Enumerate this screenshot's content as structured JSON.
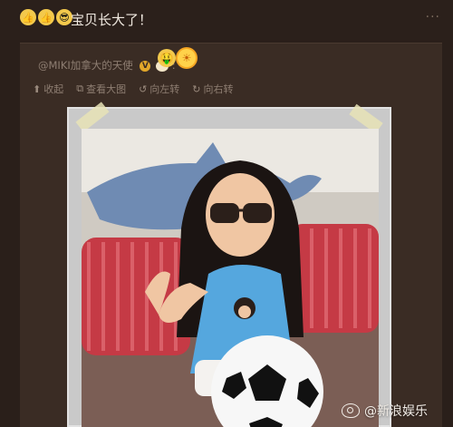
{
  "post": {
    "text": "宝贝长大了！",
    "emojis": [
      "thumbs-up-icon",
      "thumbs-up-icon",
      "cool-face-icon"
    ],
    "menu": "···"
  },
  "repost": {
    "username": "@MIKI加拿大的天使",
    "verified_badge": "V",
    "emojis": [
      "money-face-icon",
      "sun-face-icon"
    ]
  },
  "actions": [
    {
      "label": "收起",
      "icon": "collapse-up-icon"
    },
    {
      "label": "查看大图",
      "icon": "view-large-icon"
    },
    {
      "label": "向左转",
      "icon": "rotate-left-icon"
    },
    {
      "label": "向右转",
      "icon": "rotate-right-icon"
    }
  ],
  "watermark": {
    "text": "@新浪娱乐",
    "logo": "weibo-logo-icon"
  },
  "colors": {
    "background": "#2a1f1a",
    "card": "#3a2c24",
    "muted_text": "#8e7e72"
  }
}
